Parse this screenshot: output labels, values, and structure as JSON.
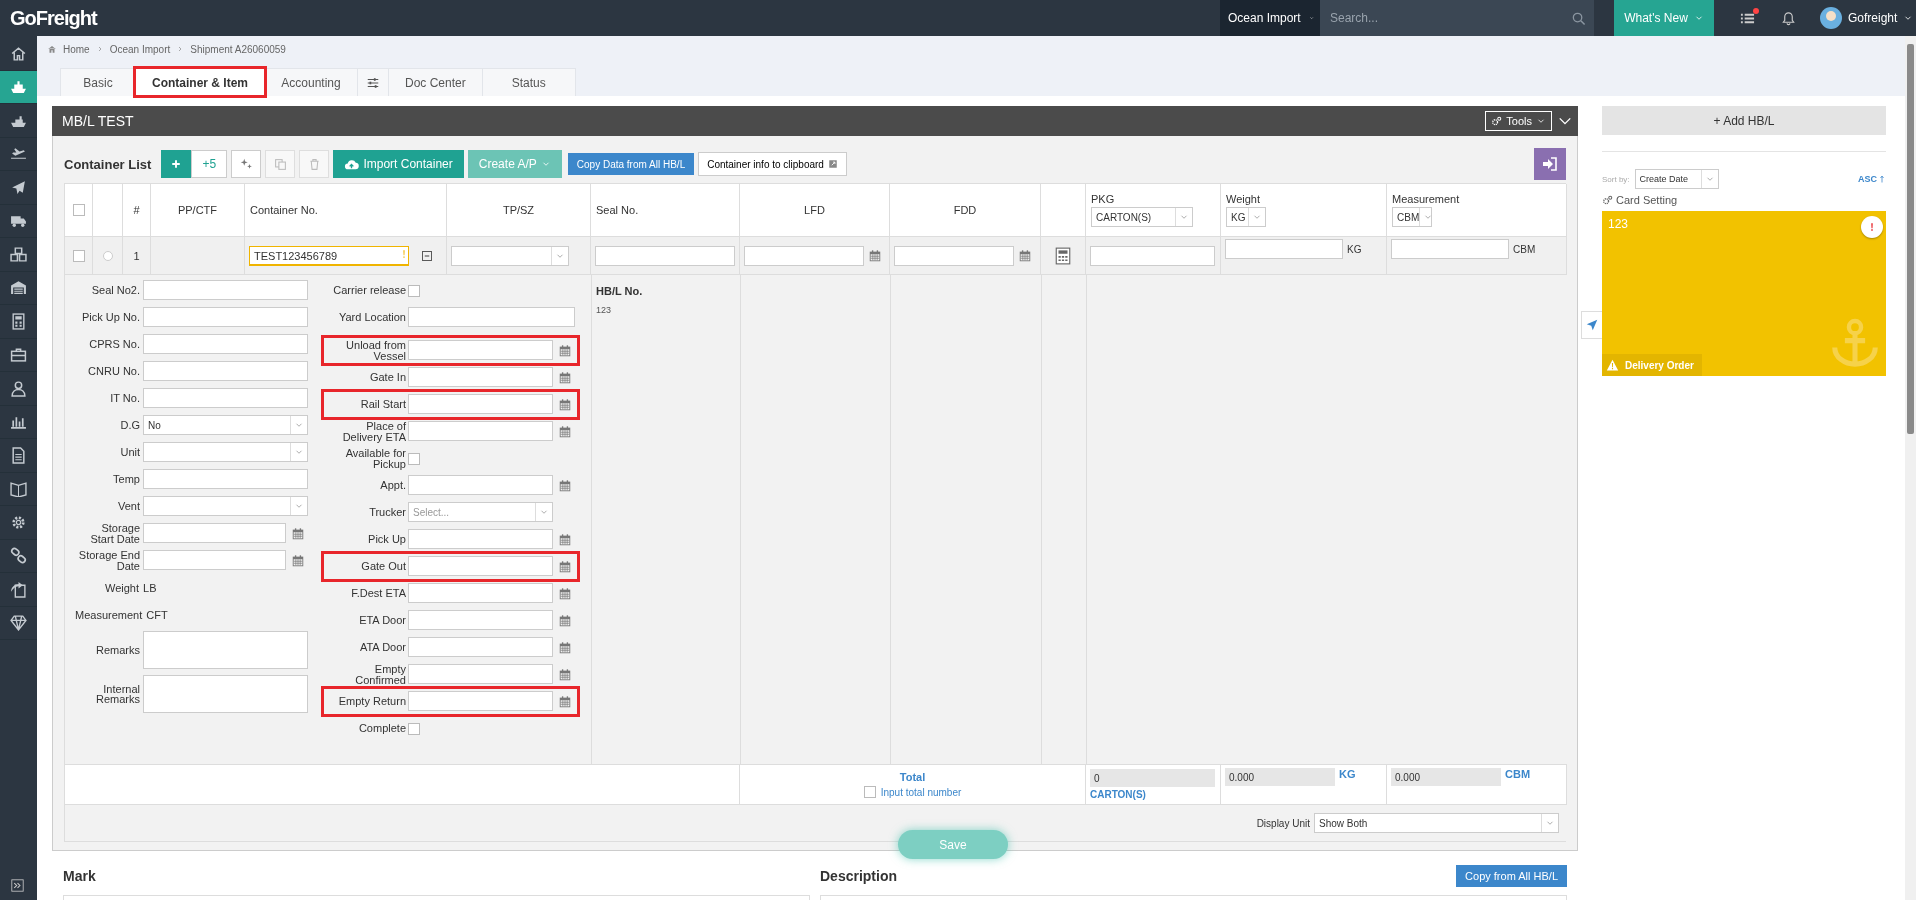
{
  "topbar": {
    "logo": "GoFreight",
    "mode": "Ocean Import",
    "search": {
      "placeholder": "Search..."
    },
    "whats_new": "What's New",
    "tasks_unread": true,
    "user": "Gofreight"
  },
  "sidebar": {
    "items": [
      {
        "selected": false
      },
      {
        "selected": true
      },
      {
        "selected": false
      },
      {
        "selected": false
      },
      {
        "selected": false
      },
      {
        "selected": false
      },
      {
        "selected": false
      },
      {
        "selected": false
      },
      {
        "selected": false
      },
      {
        "selected": false
      },
      {
        "selected": false
      },
      {
        "selected": false
      },
      {
        "selected": false
      },
      {
        "selected": false
      },
      {
        "selected": false
      },
      {
        "selected": false
      },
      {
        "selected": false
      },
      {
        "selected": false
      }
    ]
  },
  "breadcrumb": [
    "Home",
    "Ocean Import",
    "Shipment A26060059"
  ],
  "tabs": [
    {
      "kind": "text",
      "label": "Basic",
      "selected": false,
      "highlighted": false
    },
    {
      "kind": "text",
      "label": "Container & Item",
      "selected": true,
      "highlighted": true
    },
    {
      "kind": "text",
      "label": "Accounting",
      "selected": false,
      "highlighted": false
    },
    {
      "kind": "icon"
    },
    {
      "kind": "text",
      "label": "Doc Center",
      "selected": false,
      "highlighted": false
    },
    {
      "kind": "text",
      "label": "Status",
      "selected": false,
      "highlighted": false
    }
  ],
  "panel": {
    "title": "MB/L TEST",
    "tools": "Tools"
  },
  "toolbar": {
    "title": "Container List",
    "buttons": [
      {
        "kind": "add",
        "disabled": false
      },
      {
        "kind": "add-many",
        "label": "+5",
        "disabled": false
      },
      {
        "kind": "wand",
        "disabled": false
      },
      {
        "kind": "copy",
        "disabled": true
      },
      {
        "kind": "delete",
        "disabled": true
      },
      {
        "kind": "import",
        "label": "Import Container",
        "disabled": false
      },
      {
        "kind": "dropdown",
        "label": "Create A/P",
        "disabled": false
      },
      {
        "kind": "blue",
        "label": "Copy Data from All HB/L",
        "disabled": false
      },
      {
        "kind": "clipboard",
        "label": "Container info to clipboard",
        "disabled": false
      }
    ]
  },
  "table": {
    "columns": [
      {
        "kind": "check",
        "checked": false
      },
      {
        "kind": "blank"
      },
      {
        "kind": "text",
        "label": "#"
      },
      {
        "kind": "text",
        "label": "PP/CTF"
      },
      {
        "kind": "text",
        "label": "Container No."
      },
      {
        "kind": "text",
        "label": "TP/SZ"
      },
      {
        "kind": "text",
        "label": "Seal No."
      },
      {
        "kind": "text",
        "label": "LFD"
      },
      {
        "kind": "text",
        "label": "FDD"
      },
      {
        "kind": "blank"
      },
      {
        "kind": "unit",
        "label": "PKG",
        "unit": "CARTON(S)"
      },
      {
        "kind": "unit",
        "label": "Weight",
        "unit": "KG"
      },
      {
        "kind": "unit",
        "label": "Measurement",
        "unit": "CBM"
      }
    ],
    "rows": [
      {
        "checked": false,
        "selected": false,
        "number": "1",
        "container_no": "TEST123456789",
        "warning": true,
        "expanded": true,
        "weight_unit": "KG",
        "measurement_unit": "CBM"
      }
    ],
    "detail": {
      "left": [
        {
          "kind": "text",
          "label": "Seal No2."
        },
        {
          "kind": "text",
          "label": "Pick Up No."
        },
        {
          "kind": "text",
          "label": "CPRS No."
        },
        {
          "kind": "text",
          "label": "CNRU No."
        },
        {
          "kind": "text",
          "label": "IT No."
        },
        {
          "kind": "select",
          "label": "D.G",
          "value": "No"
        },
        {
          "kind": "select",
          "label": "Unit"
        },
        {
          "kind": "text",
          "label": "Temp"
        },
        {
          "kind": "select",
          "label": "Vent"
        },
        {
          "kind": "date",
          "label": "Storage Start Date"
        },
        {
          "kind": "date",
          "label": "Storage End Date"
        },
        {
          "kind": "unit",
          "label": "Weight",
          "unit": "LB"
        },
        {
          "kind": "unit",
          "label": "Measurement",
          "unit": "CFT"
        },
        {
          "kind": "textarea",
          "label": "Remarks"
        },
        {
          "kind": "textarea",
          "label": "Internal Remarks"
        }
      ],
      "middle": [
        {
          "kind": "check",
          "label": "Carrier release",
          "checked": false,
          "highlighted": false
        },
        {
          "kind": "text",
          "label": "Yard Location",
          "highlighted": false
        },
        {
          "kind": "date",
          "label": "Unload from Vessel",
          "highlighted": true
        },
        {
          "kind": "date",
          "label": "Gate In",
          "highlighted": false
        },
        {
          "kind": "date",
          "label": "Rail Start",
          "highlighted": true
        },
        {
          "kind": "date",
          "label": "Place of Delivery ETA",
          "highlighted": false
        },
        {
          "kind": "check",
          "label": "Available for Pickup",
          "checked": false,
          "highlighted": false
        },
        {
          "kind": "date",
          "label": "Appt.",
          "highlighted": false
        },
        {
          "kind": "select",
          "label": "Trucker",
          "placeholder": "Select...",
          "highlighted": false
        },
        {
          "kind": "date",
          "label": "Pick Up",
          "highlighted": false
        },
        {
          "kind": "date",
          "label": "Gate Out",
          "highlighted": true
        },
        {
          "kind": "date",
          "label": "F.Dest ETA",
          "highlighted": false
        },
        {
          "kind": "date",
          "label": "ETA Door",
          "highlighted": false
        },
        {
          "kind": "date",
          "label": "ATA Door",
          "highlighted": false
        },
        {
          "kind": "date",
          "label": "Empty Confirmed",
          "highlighted": false
        },
        {
          "kind": "date",
          "label": "Empty Return",
          "highlighted": true
        },
        {
          "kind": "check",
          "label": "Complete",
          "checked": false,
          "highlighted": false
        }
      ],
      "hbl": {
        "title": "HB/L No.",
        "values": [
          "123"
        ]
      }
    },
    "totals": {
      "label": "Total",
      "input_total": {
        "label": "Input total number",
        "checked": false
      },
      "pkg": "0",
      "pkg_unit": "CARTON(S)",
      "weight": "0.000",
      "weight_unit": "KG",
      "measurement": "0.000",
      "measurement_unit": "CBM"
    },
    "display_unit": {
      "label": "Display Unit",
      "value": "Show Both"
    }
  },
  "save": "Save",
  "mark": {
    "title": "Mark"
  },
  "description": {
    "title": "Description",
    "button": "Copy from All HB/L"
  },
  "right": {
    "add": "+ Add HB/L",
    "sort_label": "Sort by:",
    "sort_value": "Create Date",
    "order": "ASC",
    "card_setting": "Card Setting",
    "cards": [
      {
        "title": "123",
        "alert": true,
        "status": "Delivery Order"
      }
    ]
  }
}
